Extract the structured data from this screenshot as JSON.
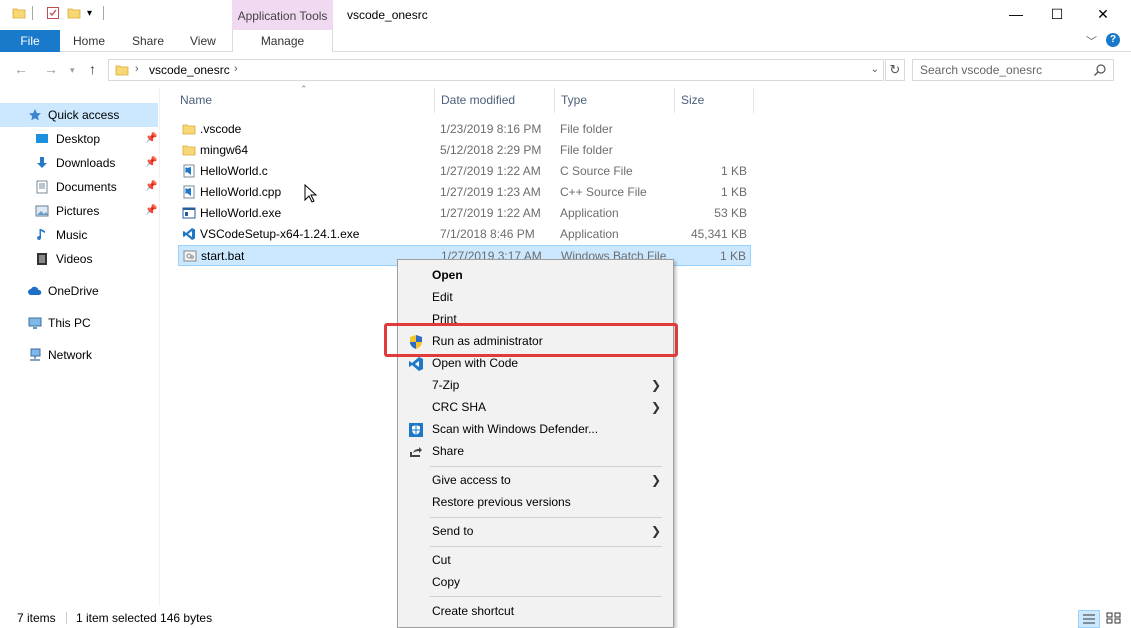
{
  "titlebar": {
    "app_tools_tab": "Application Tools",
    "window_title": "vscode_onesrc",
    "minimize": "—",
    "maximize": "☐",
    "close": "✕"
  },
  "ribbon": {
    "tabs": {
      "file": "File",
      "home": "Home",
      "share": "Share",
      "view": "View",
      "manage": "Manage"
    },
    "help": "?"
  },
  "address": {
    "path": "vscode_onesrc",
    "search_placeholder": "Search vscode_onesrc"
  },
  "sidebar": {
    "items": [
      {
        "label": "Quick access",
        "icon": "star-icon"
      },
      {
        "label": "Desktop",
        "icon": "desktop-icon"
      },
      {
        "label": "Downloads",
        "icon": "downloads-icon"
      },
      {
        "label": "Documents",
        "icon": "documents-icon"
      },
      {
        "label": "Pictures",
        "icon": "pictures-icon"
      },
      {
        "label": "Music",
        "icon": "music-icon"
      },
      {
        "label": "Videos",
        "icon": "videos-icon"
      },
      {
        "label": "OneDrive",
        "icon": "cloud-icon"
      },
      {
        "label": "This PC",
        "icon": "computer-icon"
      },
      {
        "label": "Network",
        "icon": "network-icon"
      }
    ]
  },
  "filelist": {
    "columns": {
      "name": "Name",
      "date": "Date modified",
      "type": "Type",
      "size": "Size"
    },
    "rows": [
      {
        "name": ".vscode",
        "date": "1/23/2019 8:16 PM",
        "type": "File folder",
        "size": "",
        "icon": "folder-icon"
      },
      {
        "name": "mingw64",
        "date": "5/12/2018 2:29 PM",
        "type": "File folder",
        "size": "",
        "icon": "folder-icon"
      },
      {
        "name": "HelloWorld.c",
        "date": "1/27/2019 1:22 AM",
        "type": "C Source File",
        "size": "1 KB",
        "icon": "vscode-file-icon"
      },
      {
        "name": "HelloWorld.cpp",
        "date": "1/27/2019 1:23 AM",
        "type": "C++ Source File",
        "size": "1 KB",
        "icon": "vscode-file-icon"
      },
      {
        "name": "HelloWorld.exe",
        "date": "1/27/2019 1:22 AM",
        "type": "Application",
        "size": "53 KB",
        "icon": "exe-icon"
      },
      {
        "name": "VSCodeSetup-x64-1.24.1.exe",
        "date": "7/1/2018 8:46 PM",
        "type": "Application",
        "size": "45,341 KB",
        "icon": "vscode-icon"
      },
      {
        "name": "start.bat",
        "date": "1/27/2019 3:17 AM",
        "type": "Windows Batch File",
        "size": "1 KB",
        "icon": "batch-file-icon"
      }
    ]
  },
  "status": {
    "count": "7 items",
    "selection": "1 item selected  146 bytes"
  },
  "context_menu": {
    "items": [
      {
        "label": "Open",
        "bold": true
      },
      {
        "label": "Edit"
      },
      {
        "label": "Print"
      },
      {
        "label": "Run as administrator",
        "icon": "uac-shield-icon"
      },
      {
        "label": "Open with Code",
        "icon": "vscode-icon"
      },
      {
        "label": "7-Zip",
        "submenu": true
      },
      {
        "label": "CRC SHA",
        "submenu": true
      },
      {
        "label": "Scan with Windows Defender...",
        "icon": "defender-icon"
      },
      {
        "label": "Share",
        "icon": "share-icon"
      },
      {
        "label": "Give access to",
        "submenu": true
      },
      {
        "label": "Restore previous versions"
      },
      {
        "label": "Send to",
        "submenu": true
      },
      {
        "label": "Cut"
      },
      {
        "label": "Copy"
      },
      {
        "label": "Create shortcut"
      }
    ]
  },
  "colors": {
    "accent": "#1979ca",
    "selection": "#cce8ff",
    "highlight_border": "#e03a3a",
    "app_tools_bg": "#f2d9f2"
  }
}
